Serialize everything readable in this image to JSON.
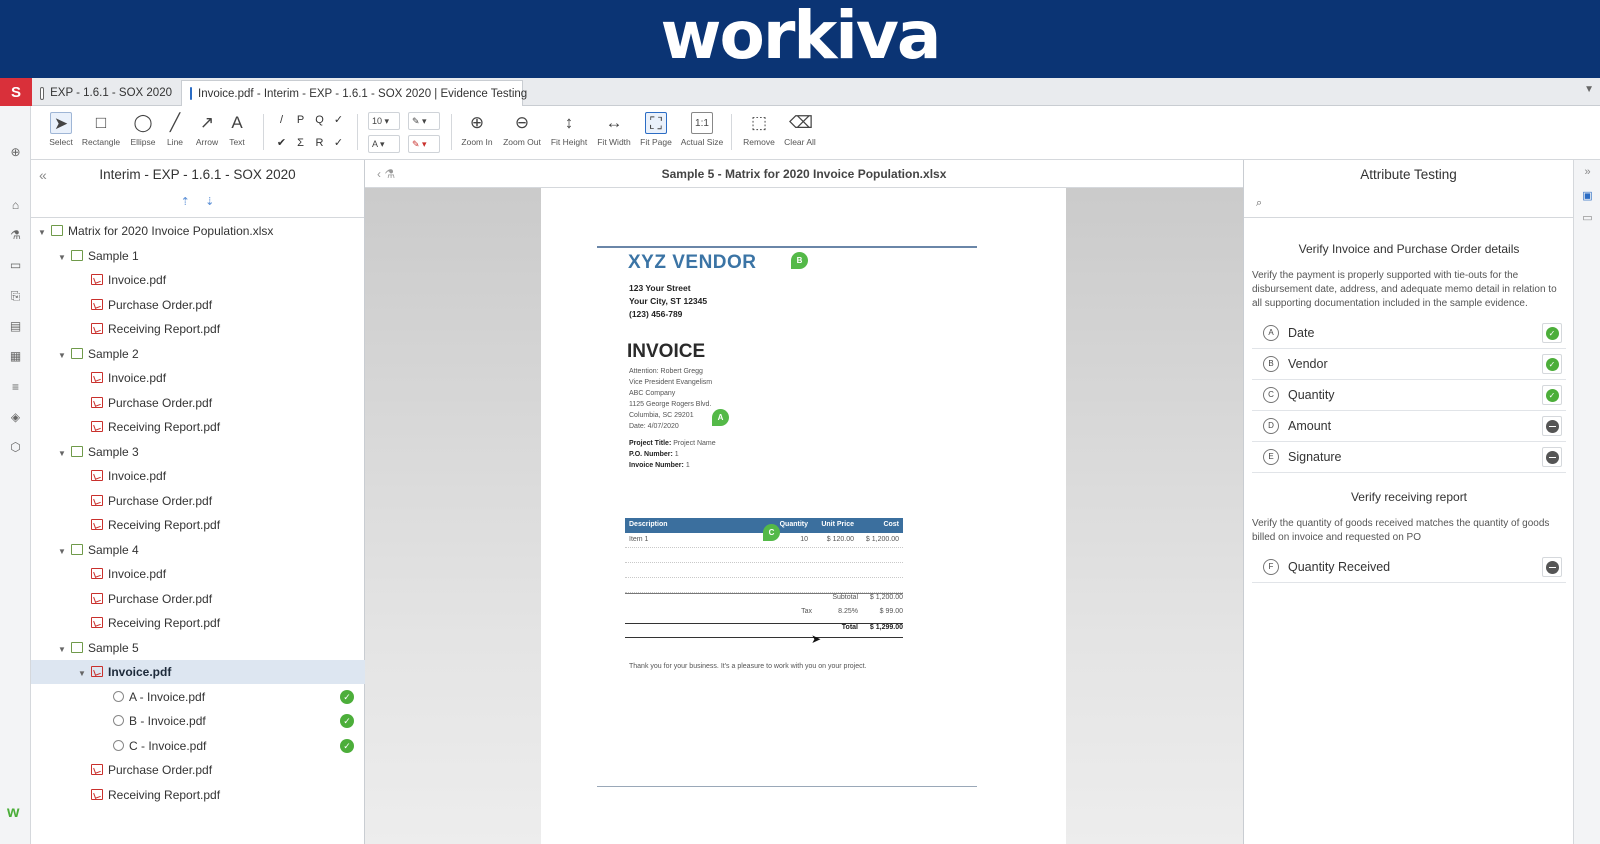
{
  "brand": {
    "logo_text": "workiva"
  },
  "app_badge": "S",
  "tabs": [
    {
      "label": "EXP - 1.6.1 - SOX 2020",
      "active": false
    },
    {
      "label": "Invoice.pdf - Interim - EXP - 1.6.1 - SOX 2020 | Evidence Testing",
      "active": true
    }
  ],
  "toolbar": {
    "select": "Select",
    "rectangle": "Rectangle",
    "ellipse": "Ellipse",
    "line": "Line",
    "arrow": "Arrow",
    "text": "Text",
    "font_size": "10",
    "zoom_in": "Zoom In",
    "zoom_out": "Zoom Out",
    "fit_height": "Fit Height",
    "fit_width": "Fit Width",
    "fit_page": "Fit Page",
    "actual_size": "Actual Size",
    "remove": "Remove",
    "clear_all": "Clear All"
  },
  "outline": {
    "title": "Interim - EXP - 1.6.1 - SOX 2020",
    "root": "Matrix for 2020 Invoice Population.xlsx",
    "sample1": "Sample 1",
    "sample2": "Sample 2",
    "sample3": "Sample 3",
    "sample4": "Sample 4",
    "sample5": "Sample 5",
    "invoice": "Invoice.pdf",
    "purchase_order": "Purchase Order.pdf",
    "receiving_report": "Receiving Report.pdf",
    "note_a": "A - Invoice.pdf",
    "note_b": "B - Invoice.pdf",
    "note_c": "C - Invoice.pdf"
  },
  "viewer": {
    "title": "Sample 5 - Matrix for 2020 Invoice Population.xlsx"
  },
  "invoice_doc": {
    "vendor": "XYZ VENDOR",
    "street": "123 Your Street",
    "city": "Your City, ST 12345",
    "phone": "(123) 456-789",
    "title": "INVOICE",
    "attention": "Attention: Robert Gregg",
    "role": "Vice President Evangelism",
    "company": "ABC Company",
    "street2": "1125 George Rogers Blvd.",
    "city2": "Columbia, SC 29201",
    "date": "Date: 4/07/2020",
    "project_label": "Project Title:",
    "project_value": "Project Name",
    "po_label": "P.O. Number:",
    "po_value": "1",
    "invnum_label": "Invoice Number:",
    "invnum_value": "1",
    "col_description": "Description",
    "col_quantity": "Quantity",
    "col_unit_price": "Unit Price",
    "col_cost": "Cost",
    "item_desc": "Item 1",
    "item_qty": "10",
    "item_unit": "$ 120.00",
    "item_cost": "$ 1,200.00",
    "subtotal_label": "Subtotal",
    "subtotal_value": "$ 1,200.00",
    "tax_label": "Tax",
    "tax_rate": "8.25%",
    "tax_value": "$ 99.00",
    "total_label": "Total",
    "total_value": "$ 1,299.00",
    "thanks": "Thank you for your business. It's a pleasure to work with you on your project.",
    "pin_a": "A",
    "pin_b": "B",
    "pin_c": "C"
  },
  "attribute_panel": {
    "title": "Attribute Testing",
    "section1_title": "Verify Invoice and Purchase Order details",
    "section1_desc": "Verify the payment is properly supported with tie-outs for the disbursement date, address, and adequate memo detail in relation to all supporting documentation included in the sample evidence.",
    "section2_title": "Verify receiving report",
    "section2_desc": "Verify the quantity of goods received matches the quantity of goods billed on invoice and requested on PO",
    "attributes": [
      {
        "letter": "A",
        "name": "Date",
        "status": "pass"
      },
      {
        "letter": "B",
        "name": "Vendor",
        "status": "pass"
      },
      {
        "letter": "C",
        "name": "Quantity",
        "status": "pass"
      },
      {
        "letter": "D",
        "name": "Amount",
        "status": "not-tested"
      },
      {
        "letter": "E",
        "name": "Signature",
        "status": "not-tested"
      },
      {
        "letter": "F",
        "name": "Quantity Received",
        "status": "not-tested"
      }
    ]
  },
  "colors": {
    "brand_blue": "#0b3474",
    "pass_green": "#4cae3a",
    "badge_red": "#d9303a",
    "table_header_blue": "#3b6f9e"
  }
}
